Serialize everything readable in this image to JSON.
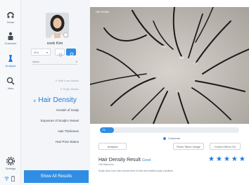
{
  "rail": {
    "items": [
      {
        "label": "Home",
        "icon": "home-icon"
      },
      {
        "label": "Customer",
        "icon": "customer-icon"
      },
      {
        "label": "Analysis",
        "icon": "analysis-icon"
      },
      {
        "label": "View",
        "icon": "view-icon"
      },
      {
        "label": "Settings",
        "icon": "settings-icon"
      }
    ],
    "active_color": "#1f7bd8"
  },
  "customer": {
    "name": "sook Kim",
    "age_select": "40's",
    "area_select": "Asian"
  },
  "menu": {
    "items": [
      {
        "label": "Hair Loss Status",
        "state": "dim"
      },
      {
        "label": "Scalp Status",
        "state": "dim"
      },
      {
        "label": "Hair Density",
        "state": "active"
      },
      {
        "label": "Keratin of Scalp",
        "state": "normal"
      },
      {
        "label": "Exposure of Scalp's Vessel",
        "state": "normal"
      },
      {
        "label": "Hair Thickness",
        "state": "normal"
      },
      {
        "label": "Hair Pore Status",
        "state": "normal"
      }
    ]
  },
  "show_all_label": "Show All Results",
  "scope": {
    "label": "Hair Density"
  },
  "density": {
    "value_label": "73",
    "fill_fraction": 0.1,
    "legend": "Customer"
  },
  "buttons": {
    "analysis": "Analysis",
    "show_taken": "Show Taken Image",
    "control_menu": "Control Menu On"
  },
  "result": {
    "title": "Hair Density Result",
    "grade": "Good",
    "sub": "130 Hairs/cm²",
    "desc": "Scalp area 1cm² has normal level of hair and healthy scalp condition.",
    "stars": 5,
    "star_color": "#1f7bd8"
  },
  "colors": {
    "accent": "#2f8de4"
  }
}
